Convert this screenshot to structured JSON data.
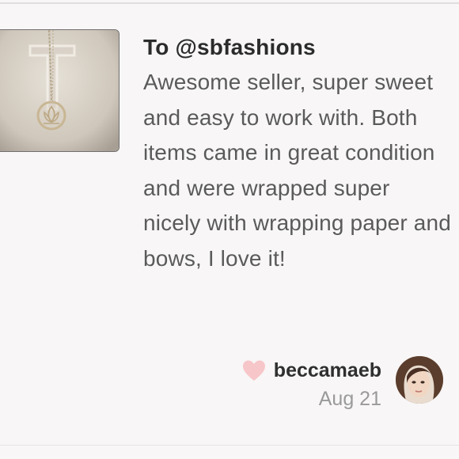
{
  "review": {
    "recipient": "To @sbfashions",
    "message": "Awesome seller, super sweet and easy to work with. Both items came in great condition and were wrapped super nicely with wrapping paper and bows, I love it!",
    "author": "beccamaeb",
    "date": "Aug 21"
  },
  "icons": {
    "like": "heart-icon"
  },
  "colors": {
    "heart": "#f7c6c9",
    "background": "#f8f6f6"
  }
}
